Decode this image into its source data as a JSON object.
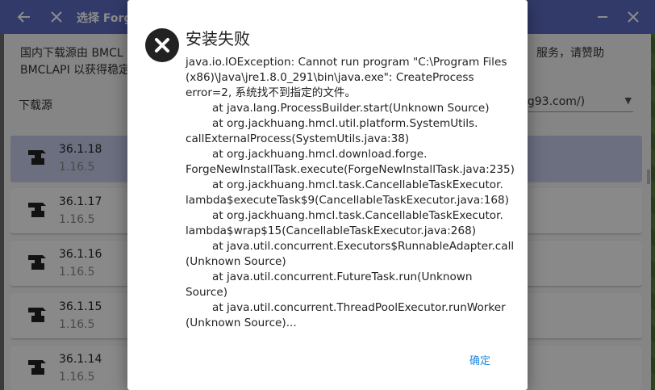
{
  "window": {
    "title": "选择 Forge",
    "back_icon": "back-arrow-icon",
    "close_icon": "close-icon",
    "minimize_icon": "minimize-icon",
    "window_close_icon": "window-close-icon"
  },
  "notice": {
    "line1": "国内下载源由 BMCL",
    "line2": "BMCLAPI 以获得稳定",
    "right_line1": "服务，请赞助",
    "right_line2": ""
  },
  "source": {
    "label": "下载源",
    "selected": "ng93.com/)"
  },
  "versions": [
    {
      "version": "36.1.18",
      "mc": "1.16.5",
      "selected": true
    },
    {
      "version": "36.1.17",
      "mc": "1.16.5",
      "selected": false
    },
    {
      "version": "36.1.16",
      "mc": "1.16.5",
      "selected": false
    },
    {
      "version": "36.1.15",
      "mc": "1.16.5",
      "selected": false
    },
    {
      "version": "36.1.14",
      "mc": "1.16.5",
      "selected": false
    }
  ],
  "dialog": {
    "title": "安装失败",
    "icon": "error-x-icon",
    "lines": [
      {
        "text": "java.io.IOException: Cannot run program \"C:\\Program Files",
        "indent": false
      },
      {
        "text": "(x86)\\Java\\jre1.8.0_291\\bin\\java.exe\": CreateProcess",
        "indent": false
      },
      {
        "text": "error=2, 系统找不到指定的文件。",
        "indent": false
      },
      {
        "text": "at java.lang.ProcessBuilder.start(Unknown Source)",
        "indent": true
      },
      {
        "text": "at org.jackhuang.hmcl.util.platform.SystemUtils.",
        "indent": true
      },
      {
        "text": "callExternalProcess(SystemUtils.java:38)",
        "indent": false
      },
      {
        "text": "at org.jackhuang.hmcl.download.forge.",
        "indent": true
      },
      {
        "text": "ForgeNewInstallTask.execute(ForgeNewInstallTask.java:235)",
        "indent": false
      },
      {
        "text": "at org.jackhuang.hmcl.task.CancellableTaskExecutor.",
        "indent": true
      },
      {
        "text": "lambda$executeTask$9(CancellableTaskExecutor.java:168)",
        "indent": false
      },
      {
        "text": "at org.jackhuang.hmcl.task.CancellableTaskExecutor.",
        "indent": true
      },
      {
        "text": "lambda$wrap$15(CancellableTaskExecutor.java:268)",
        "indent": false
      },
      {
        "text": "at java.util.concurrent.Executors$RunnableAdapter.call",
        "indent": true
      },
      {
        "text": "(Unknown Source)",
        "indent": false
      },
      {
        "text": "at java.util.concurrent.FutureTask.run(Unknown",
        "indent": true
      },
      {
        "text": "Source)",
        "indent": false
      },
      {
        "text": "at java.util.concurrent.ThreadPoolExecutor.runWorker",
        "indent": true
      },
      {
        "text": "(Unknown Source)...",
        "indent": false
      }
    ],
    "ok_label": "确定"
  },
  "colors": {
    "titlebar": "#5c6bc0",
    "selected_item": "#c5cae9",
    "ok_button": "#1e88e5"
  }
}
